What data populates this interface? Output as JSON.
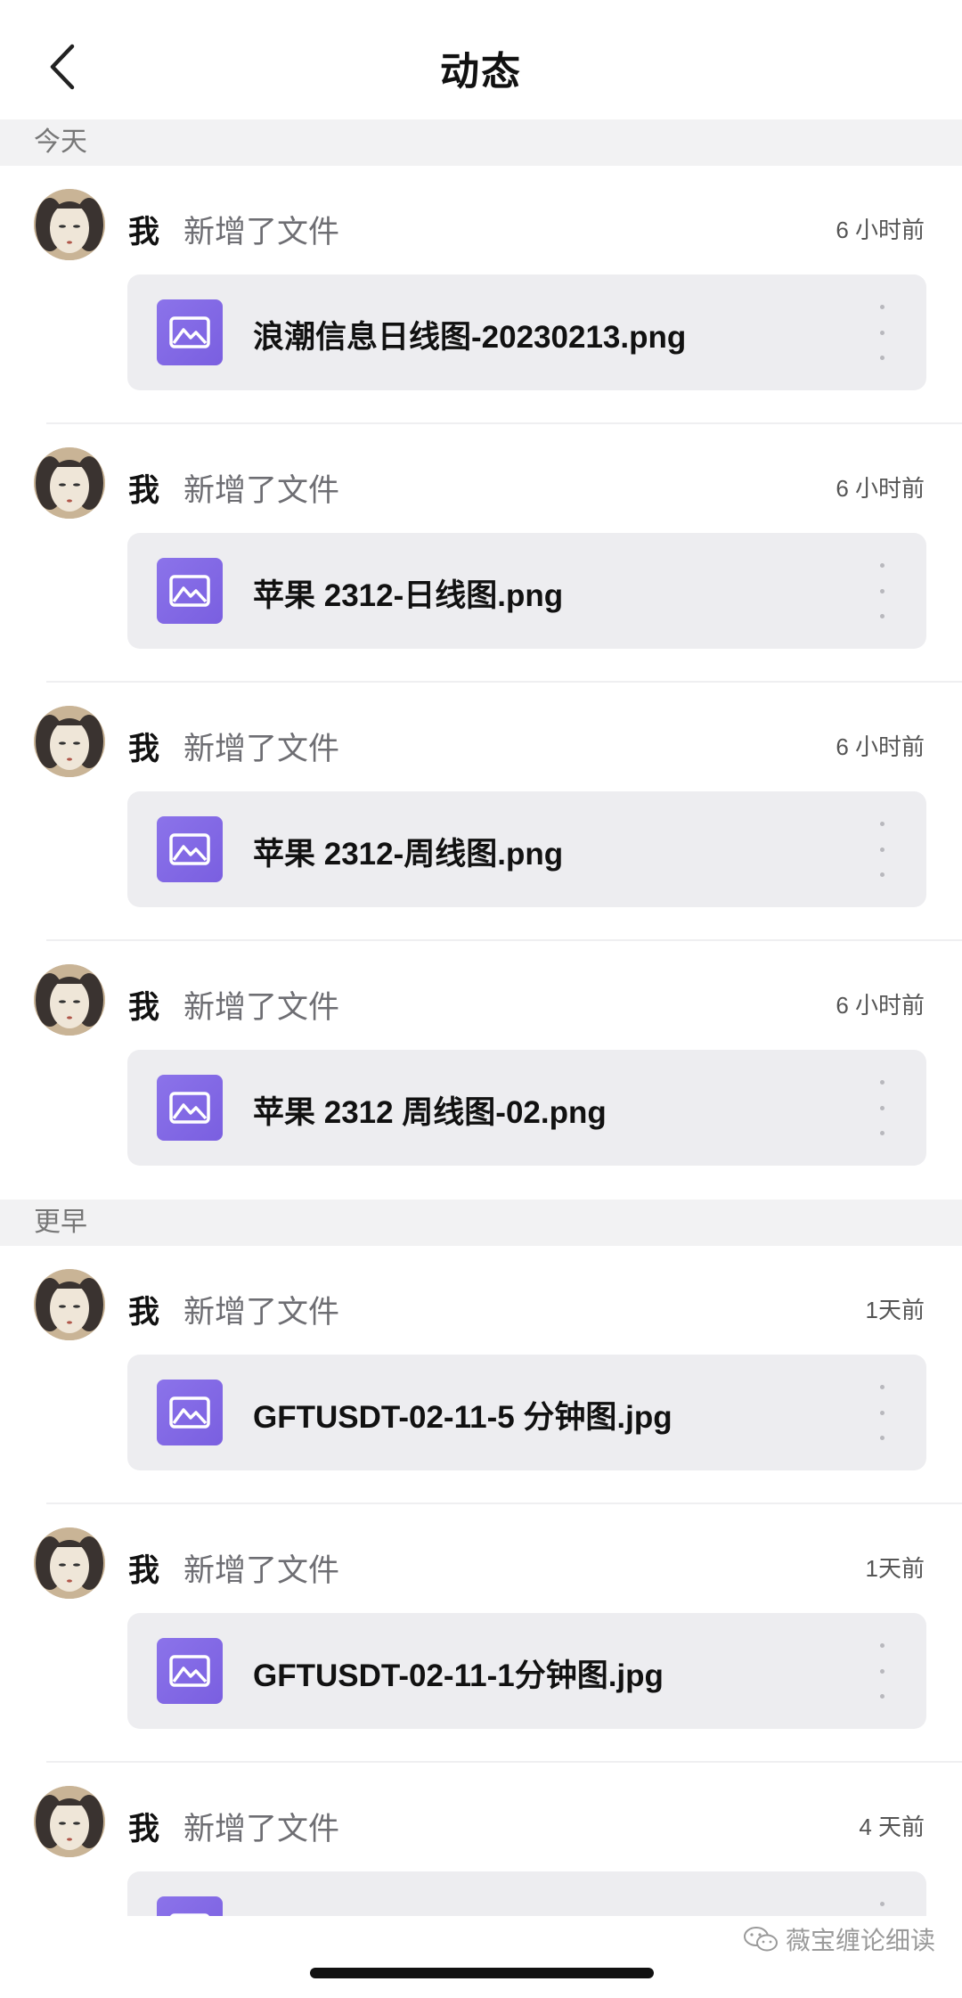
{
  "header": {
    "title": "动态",
    "back_icon": "chevron-left-icon"
  },
  "sections": [
    {
      "label": "今天",
      "items": [
        {
          "actor": "我",
          "action": "新增了文件",
          "time": "6 小时前",
          "file": "浪潮信息日线图-20230213.png"
        },
        {
          "actor": "我",
          "action": "新增了文件",
          "time": "6 小时前",
          "file": "苹果 2312-日线图.png"
        },
        {
          "actor": "我",
          "action": "新增了文件",
          "time": "6 小时前",
          "file": "苹果 2312-周线图.png"
        },
        {
          "actor": "我",
          "action": "新增了文件",
          "time": "6 小时前",
          "file": "苹果 2312 周线图-02.png"
        }
      ]
    },
    {
      "label": "更早",
      "items": [
        {
          "actor": "我",
          "action": "新增了文件",
          "time": "1天前",
          "file": "GFTUSDT-02-11-5 分钟图.jpg"
        },
        {
          "actor": "我",
          "action": "新增了文件",
          "time": "1天前",
          "file": "GFTUSDT-02-11-1分钟图.jpg"
        },
        {
          "actor": "我",
          "action": "新增了文件",
          "time": "4 天前",
          "file": ""
        }
      ]
    }
  ],
  "watermark": {
    "text": "薇宝缠论细读",
    "icon": "wechat-icon"
  },
  "colors": {
    "file_icon": "#7e66e4",
    "section_bg": "#f2f2f3",
    "card_bg": "#ededf0"
  }
}
